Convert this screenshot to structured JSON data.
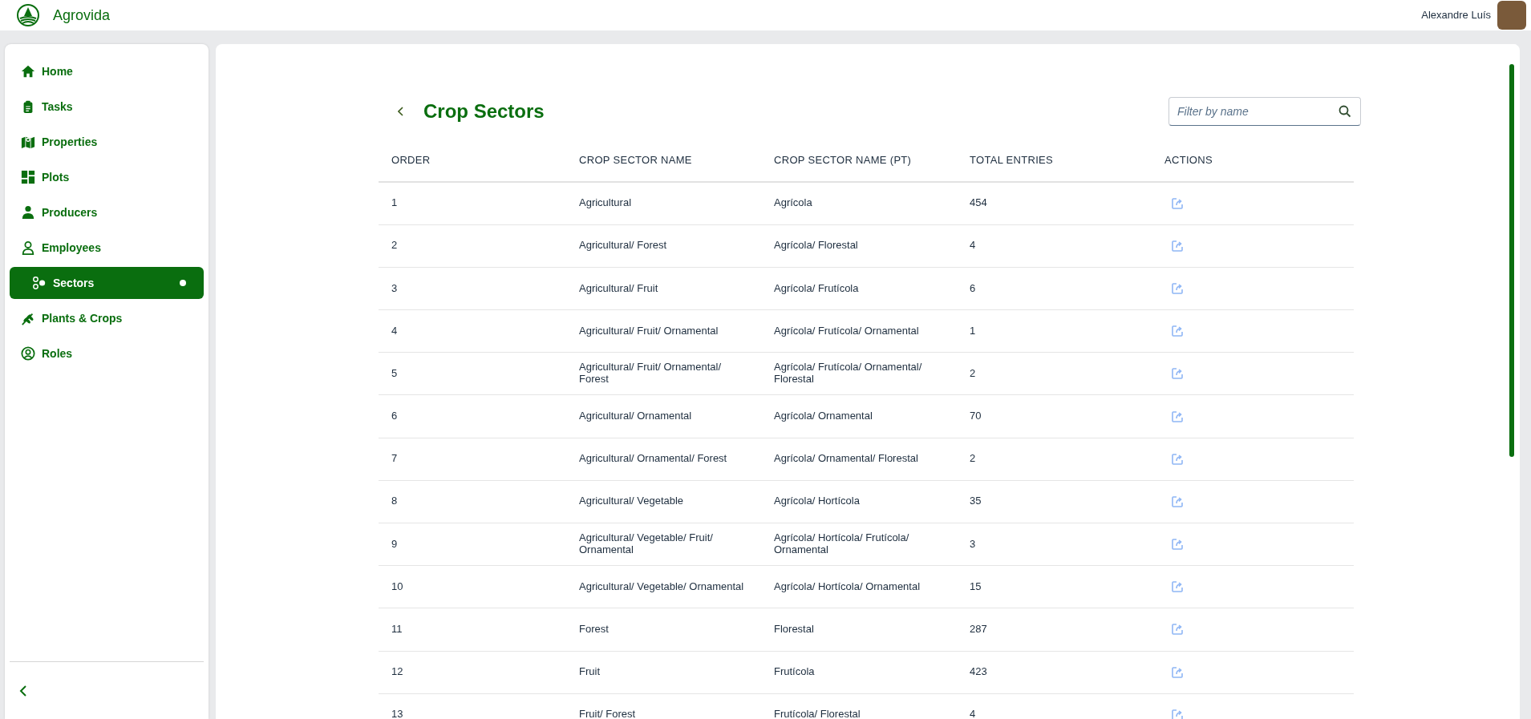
{
  "header": {
    "app_name": "Agrovida",
    "user_name": "Alexandre Luís"
  },
  "sidebar": {
    "items": [
      {
        "label": "Home",
        "selected": false
      },
      {
        "label": "Tasks",
        "selected": false
      },
      {
        "label": "Properties",
        "selected": false
      },
      {
        "label": "Plots",
        "selected": false
      },
      {
        "label": "Producers",
        "selected": false
      },
      {
        "label": "Employees",
        "selected": false
      },
      {
        "label": "Sectors",
        "selected": true
      },
      {
        "label": "Plants & Crops",
        "selected": false
      },
      {
        "label": "Roles",
        "selected": false
      }
    ]
  },
  "page": {
    "title": "Crop Sectors",
    "search": {
      "placeholder": "Filter by name"
    }
  },
  "table": {
    "columns": [
      "ORDER",
      "CROP SECTOR NAME",
      "CROP SECTOR NAME (PT)",
      "TOTAL ENTRIES",
      "ACTIONS"
    ],
    "rows": [
      {
        "order": "1",
        "name": "Agricultural",
        "name_pt": "Agrícola",
        "total": "454"
      },
      {
        "order": "2",
        "name": "Agricultural/ Forest",
        "name_pt": "Agrícola/ Florestal",
        "total": "4"
      },
      {
        "order": "3",
        "name": "Agricultural/ Fruit",
        "name_pt": "Agrícola/ Frutícola",
        "total": "6"
      },
      {
        "order": "4",
        "name": "Agricultural/ Fruit/ Ornamental",
        "name_pt": "Agrícola/ Frutícola/ Ornamental",
        "total": "1"
      },
      {
        "order": "5",
        "name": "Agricultural/ Fruit/ Ornamental/ Forest",
        "name_pt": "Agrícola/ Frutícola/ Ornamental/ Florestal",
        "total": "2"
      },
      {
        "order": "6",
        "name": "Agricultural/ Ornamental",
        "name_pt": "Agrícola/ Ornamental",
        "total": "70"
      },
      {
        "order": "7",
        "name": "Agricultural/ Ornamental/ Forest",
        "name_pt": "Agrícola/ Ornamental/ Florestal",
        "total": "2"
      },
      {
        "order": "8",
        "name": "Agricultural/ Vegetable",
        "name_pt": "Agrícola/ Hortícola",
        "total": "35"
      },
      {
        "order": "9",
        "name": "Agricultural/ Vegetable/ Fruit/ Ornamental",
        "name_pt": "Agrícola/ Hortícola/ Frutícola/ Ornamental",
        "total": "3"
      },
      {
        "order": "10",
        "name": "Agricultural/ Vegetable/ Ornamental",
        "name_pt": "Agrícola/ Hortícola/ Ornamental",
        "total": "15"
      },
      {
        "order": "11",
        "name": "Forest",
        "name_pt": "Florestal",
        "total": "287"
      },
      {
        "order": "12",
        "name": "Fruit",
        "name_pt": "Frutícola",
        "total": "423"
      },
      {
        "order": "13",
        "name": "Fruit/ Forest",
        "name_pt": "Frutícola/ Florestal",
        "total": "4"
      }
    ]
  }
}
